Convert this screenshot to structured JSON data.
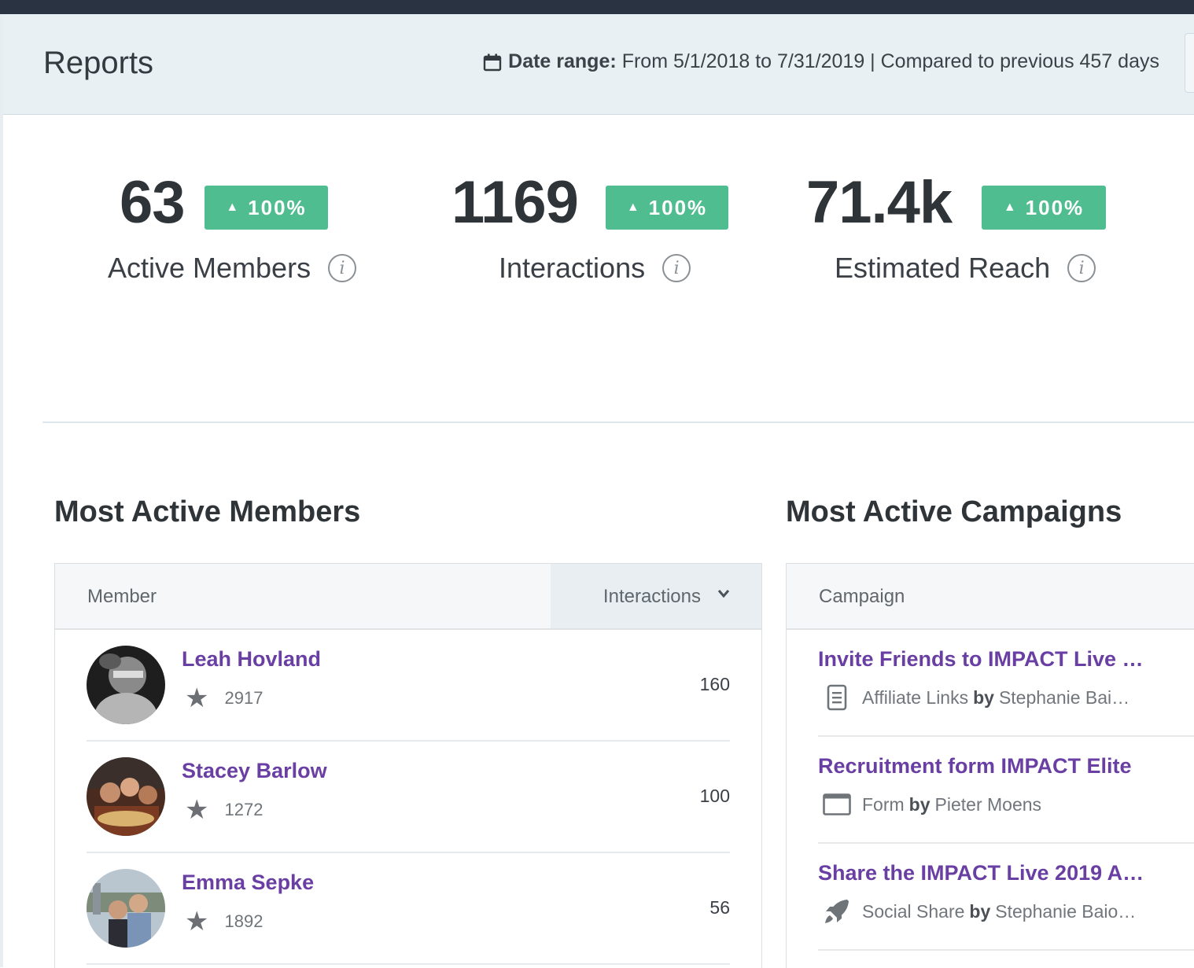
{
  "header": {
    "title": "Reports",
    "date_range_label": "Date range:",
    "date_range_value": "From 5/1/2018 to 7/31/2019 | Compared to previous 457 days"
  },
  "stats": [
    {
      "value": "63",
      "change": "100%",
      "label": "Active Members"
    },
    {
      "value": "1169",
      "change": "100%",
      "label": "Interactions"
    },
    {
      "value": "71.4k",
      "change": "100%",
      "label": "Estimated Reach"
    }
  ],
  "members_section": {
    "title": "Most Active Members",
    "col_member": "Member",
    "col_interactions": "Interactions",
    "rows": [
      {
        "name": "Leah Hovland",
        "score": "2917",
        "interactions": "160"
      },
      {
        "name": "Stacey Barlow",
        "score": "1272",
        "interactions": "100"
      },
      {
        "name": "Emma Sepke",
        "score": "1892",
        "interactions": "56"
      }
    ]
  },
  "campaigns_section": {
    "title": "Most Active Campaigns",
    "col_campaign": "Campaign",
    "by_label": "by",
    "rows": [
      {
        "name": "Invite Friends to IMPACT Live …",
        "type": "Affiliate Links",
        "author": "Stephanie Bai…",
        "icon": "document-icon"
      },
      {
        "name": "Recruitment form IMPACT Elite",
        "type": "Form",
        "author": "Pieter Moens",
        "icon": "form-window-icon"
      },
      {
        "name": "Share the IMPACT Live 2019 A…",
        "type": "Social Share",
        "author": "Stephanie Baio…",
        "icon": "rocket-icon"
      }
    ]
  },
  "colors": {
    "accent_purple": "#6a3fa3",
    "badge_green": "#4fbd8f",
    "topbar": "#2a3342",
    "header_bg": "#e9f0f4"
  }
}
